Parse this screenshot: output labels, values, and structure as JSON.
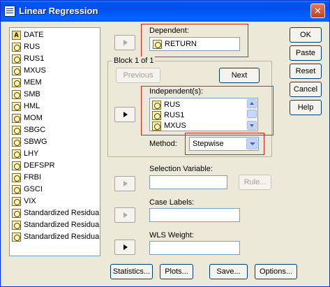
{
  "window": {
    "title": "Linear Regression",
    "close_glyph": "✕"
  },
  "variables": [
    {
      "label": "DATE",
      "icon": "string-var-icon",
      "glyph": "A"
    },
    {
      "label": "RUS",
      "icon": "scale-var-icon"
    },
    {
      "label": "RUS1",
      "icon": "scale-var-icon"
    },
    {
      "label": "MXUS",
      "icon": "scale-var-icon"
    },
    {
      "label": "MEM",
      "icon": "scale-var-icon"
    },
    {
      "label": "SMB",
      "icon": "scale-var-icon"
    },
    {
      "label": "HML",
      "icon": "scale-var-icon"
    },
    {
      "label": "MOM",
      "icon": "scale-var-icon"
    },
    {
      "label": "SBGC",
      "icon": "scale-var-icon"
    },
    {
      "label": "SBWG",
      "icon": "scale-var-icon"
    },
    {
      "label": "LHY",
      "icon": "scale-var-icon"
    },
    {
      "label": "DEFSPR",
      "icon": "scale-var-icon"
    },
    {
      "label": "FRBI",
      "icon": "scale-var-icon"
    },
    {
      "label": "GSCI",
      "icon": "scale-var-icon"
    },
    {
      "label": "VIX",
      "icon": "scale-var-icon"
    },
    {
      "label": "Standardized Residual",
      "icon": "scale-var-icon"
    },
    {
      "label": "Standardized Residual",
      "icon": "scale-var-icon"
    },
    {
      "label": "Standardized Residual",
      "icon": "scale-var-icon"
    }
  ],
  "dependent": {
    "label": "Dependent:",
    "value": "RETURN"
  },
  "block": {
    "label": "Block 1 of 1",
    "previous": "Previous",
    "next": "Next"
  },
  "independents": {
    "label": "Independent(s):",
    "items": [
      "RUS",
      "RUS1",
      "MXUS"
    ]
  },
  "method": {
    "label": "Method:",
    "value": "Stepwise"
  },
  "selection_variable": {
    "label": "Selection Variable:",
    "value": "",
    "rule_button": "Rule..."
  },
  "case_labels": {
    "label": "Case Labels:",
    "value": ""
  },
  "wls_weight": {
    "label": "WLS Weight:",
    "value": ""
  },
  "right_buttons": [
    "OK",
    "Paste",
    "Reset",
    "Cancel",
    "Help"
  ],
  "bottom_buttons": [
    "Statistics...",
    "Plots...",
    "Save...",
    "Options..."
  ],
  "colors": {
    "titlebar": "#0054e3",
    "dialog_bg": "#ece9d8",
    "highlight_box": "#d9261c"
  }
}
